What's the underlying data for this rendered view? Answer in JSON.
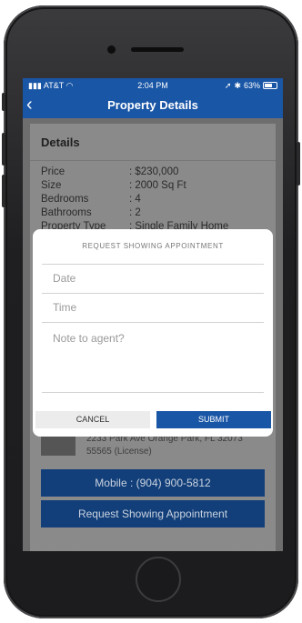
{
  "status_bar": {
    "carrier": "AT&T",
    "time": "2:04 PM",
    "battery": "63%"
  },
  "nav": {
    "title": "Property Details",
    "back_glyph": "‹"
  },
  "details": {
    "heading": "Details",
    "rows": [
      {
        "label": "Price",
        "value": ": $230,000"
      },
      {
        "label": "Size",
        "value": ": 2000 Sq Ft"
      },
      {
        "label": "Bedrooms",
        "value": ": 4"
      },
      {
        "label": "Bathrooms",
        "value": ": 2"
      },
      {
        "label": "Property Type",
        "value": ": Single Family Home"
      }
    ]
  },
  "agent": {
    "address": "2233 Park Ave Orange Park, FL 32073",
    "license": "55565 (License)"
  },
  "actions": {
    "mobile_label": "Mobile : (904) 900-5812",
    "request_label": "Request Showing Appointment"
  },
  "modal": {
    "title": "REQUEST SHOWING APPOINTMENT",
    "date_placeholder": "Date",
    "time_placeholder": "Time",
    "note_placeholder": "Note to agent?",
    "cancel_label": "CANCEL",
    "submit_label": "SUBMIT"
  },
  "icons": {
    "back": "chevron-left-icon",
    "signal": "signal-icon",
    "wifi": "wifi-icon",
    "location": "location-arrow-icon",
    "bluetooth": "bluetooth-icon",
    "battery": "battery-icon"
  },
  "colors": {
    "brand_blue": "#1a56a6",
    "dark_button": "#123f7a"
  }
}
